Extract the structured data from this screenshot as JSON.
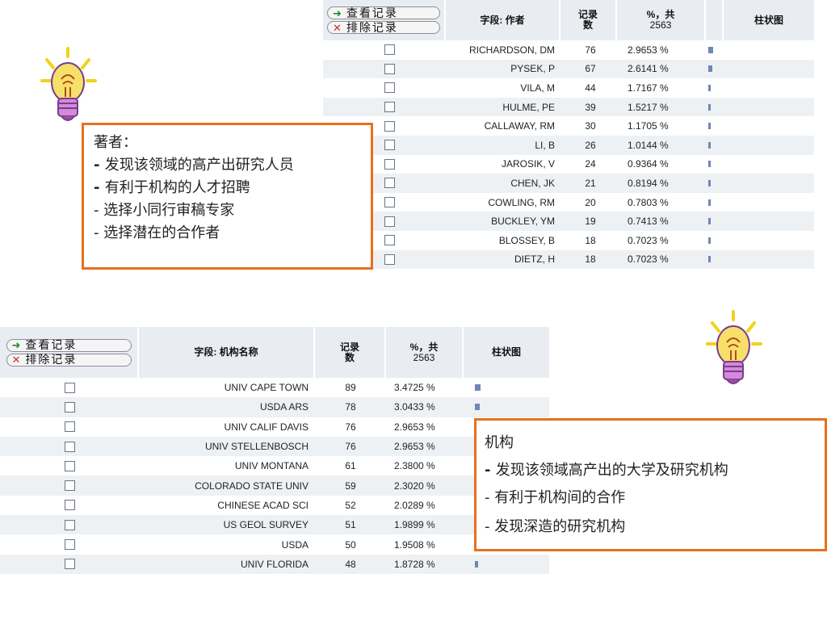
{
  "buttons": {
    "view": "查看记录",
    "exclude": "排除记录"
  },
  "author_table": {
    "field_header": "字段: 作者",
    "count_header": "记录数",
    "pct_header": "%，共",
    "pct_total": "2563",
    "bar_header": "柱状图",
    "rows": [
      {
        "name": "RICHARDSON, DM",
        "count": "76",
        "pct": "2.9653 %",
        "bar": 0.0297
      },
      {
        "name": "PYSEK, P",
        "count": "67",
        "pct": "2.6141 %",
        "bar": 0.0261
      },
      {
        "name": "VILA, M",
        "count": "44",
        "pct": "1.7167 %",
        "bar": 0.0172
      },
      {
        "name": "HULME, PE",
        "count": "39",
        "pct": "1.5217 %",
        "bar": 0.0152
      },
      {
        "name": "CALLAWAY, RM",
        "count": "30",
        "pct": "1.1705 %",
        "bar": 0.0117
      },
      {
        "name": "LI, B",
        "count": "26",
        "pct": "1.0144 %",
        "bar": 0.0101
      },
      {
        "name": "JAROSIK, V",
        "count": "24",
        "pct": "0.9364 %",
        "bar": 0.0094
      },
      {
        "name": "CHEN, JK",
        "count": "21",
        "pct": "0.8194 %",
        "bar": 0.0082
      },
      {
        "name": "COWLING, RM",
        "count": "20",
        "pct": "0.7803 %",
        "bar": 0.0078
      },
      {
        "name": "BUCKLEY, YM",
        "count": "19",
        "pct": "0.7413 %",
        "bar": 0.0074
      },
      {
        "name": "BLOSSEY, B",
        "count": "18",
        "pct": "0.7023 %",
        "bar": 0.007
      },
      {
        "name": "DIETZ, H",
        "count": "18",
        "pct": "0.7023 %",
        "bar": 0.007
      }
    ]
  },
  "org_table": {
    "field_header": "字段: 机构名称",
    "count_header": "记录数",
    "pct_header": "%，共",
    "pct_total": "2563",
    "bar_header": "柱状图",
    "rows": [
      {
        "name": "UNIV CAPE TOWN",
        "count": "89",
        "pct": "3.4725 %",
        "bar": 0.0347
      },
      {
        "name": "USDA ARS",
        "count": "78",
        "pct": "3.0433 %",
        "bar": 0.0304
      },
      {
        "name": "UNIV CALIF DAVIS",
        "count": "76",
        "pct": "2.9653 %",
        "bar": 0.0297
      },
      {
        "name": "UNIV STELLENBOSCH",
        "count": "76",
        "pct": "2.9653 %",
        "bar": 0.0297
      },
      {
        "name": "UNIV MONTANA",
        "count": "61",
        "pct": "2.3800 %",
        "bar": 0.0238
      },
      {
        "name": "COLORADO STATE UNIV",
        "count": "59",
        "pct": "2.3020 %",
        "bar": 0.023
      },
      {
        "name": "CHINESE ACAD SCI",
        "count": "52",
        "pct": "2.0289 %",
        "bar": 0.0203
      },
      {
        "name": "US GEOL SURVEY",
        "count": "51",
        "pct": "1.9899 %",
        "bar": 0.0199
      },
      {
        "name": "USDA",
        "count": "50",
        "pct": "1.9508 %",
        "bar": 0.0195
      },
      {
        "name": "UNIV FLORIDA",
        "count": "48",
        "pct": "1.8728 %",
        "bar": 0.0187
      }
    ]
  },
  "author_note": {
    "title": "著者：",
    "lines": [
      {
        "prefix": "- ",
        "text": "发现该领域的高产出研究人员",
        "bold_prefix": true
      },
      {
        "prefix": "- ",
        "text": "有利于机构的人才招聘",
        "bold_prefix": true
      },
      {
        "prefix": "- ",
        "text": "选择小同行审稿专家",
        "bold_prefix": false
      },
      {
        "prefix": "- ",
        "text": "选择潜在的合作者",
        "bold_prefix": false
      }
    ]
  },
  "org_note": {
    "title": "机构",
    "lines": [
      {
        "prefix": "- ",
        "text": "发现该领域高产出的大学及研究机构",
        "bold_prefix": true
      },
      {
        "prefix": "- ",
        "text": "有利于机构间的合作",
        "bold_prefix": false
      },
      {
        "prefix": "- ",
        "text": "发现深造的研究机构",
        "bold_prefix": false
      }
    ]
  },
  "colors": {
    "note_border": "#e8701e",
    "bar": "#6f86b8",
    "row_alt": "#eef1f4",
    "header_bg": "#e9edf2"
  },
  "icons": {
    "lightbulb": "lightbulb-icon",
    "view": "arrow-right-icon",
    "exclude": "x-icon"
  }
}
